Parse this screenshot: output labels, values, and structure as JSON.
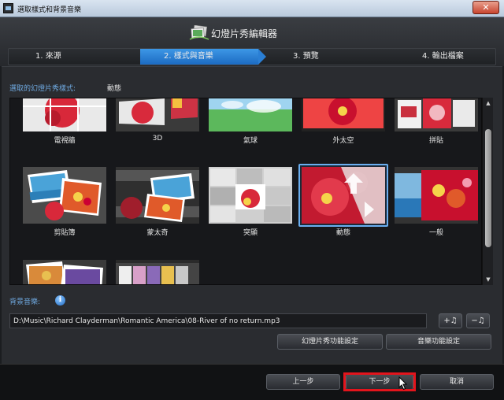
{
  "window": {
    "title": "選取樣式和背景音樂",
    "close_label": "✕"
  },
  "app": {
    "title": "幻燈片秀編輯器"
  },
  "steps": [
    {
      "label": "1. 來源"
    },
    {
      "label": "2. 樣式與音樂"
    },
    {
      "label": "3. 預覽"
    },
    {
      "label": "4. 輸出檔案"
    }
  ],
  "style_section": {
    "label": "選取的幻燈片秀樣式:",
    "selected": "動態"
  },
  "styles": [
    {
      "name": "電視牆"
    },
    {
      "name": "3D"
    },
    {
      "name": "氣球"
    },
    {
      "name": "外太空"
    },
    {
      "name": "拼貼"
    },
    {
      "name": "剪貼簿"
    },
    {
      "name": "蒙太奇"
    },
    {
      "name": "突顯"
    },
    {
      "name": "動態"
    },
    {
      "name": "一般"
    },
    {
      "name": ""
    },
    {
      "name": ""
    }
  ],
  "music": {
    "label": "背景音樂:",
    "path": "D:\\Music\\Richard Clayderman\\Romantic America\\08-River of no return.mp3",
    "add_label": "+♫",
    "remove_label": "−♫"
  },
  "buttons": {
    "slideshow_settings": "幻燈片秀功能設定",
    "music_settings": "音樂功能設定",
    "back": "上一步",
    "next": "下一步",
    "cancel": "取消"
  },
  "colors": {
    "accent": "#2a7fd5",
    "highlight": "#e3141c",
    "label_blue": "#6fa9e0"
  }
}
